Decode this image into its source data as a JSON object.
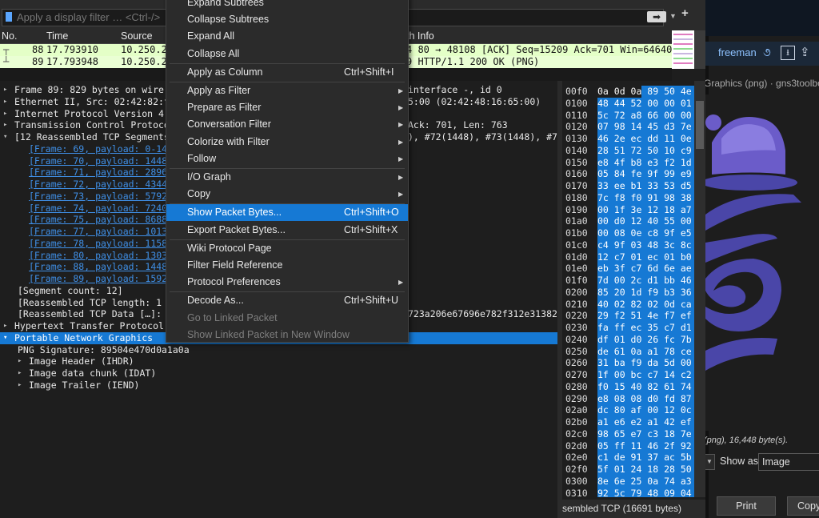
{
  "filter": {
    "placeholder": "Apply a display filter … <Ctrl-/>",
    "arrow_label": "➡",
    "dropdown": "▼",
    "add": "+"
  },
  "packet_list": {
    "columns": [
      "No.",
      "Time",
      "Source",
      "th Info"
    ],
    "rows": [
      {
        "no": "88",
        "time": "17.793910",
        "source": "10.250.25",
        "info": "4 80 → 48108 [ACK] Seq=15209 Ack=701 Win=64640 Len="
      },
      {
        "no": "89",
        "time": "17.793948",
        "source": "10.250.25",
        "info": "9 HTTP/1.1 200 OK  (PNG)"
      }
    ]
  },
  "details": {
    "lines": [
      {
        "text": "Frame 89: 829 bytes on wire (",
        "tail": "interface -, id 0",
        "twisty": "▸"
      },
      {
        "text": "Ethernet II, Src: 02:42:82:f7",
        "tail": "5:00 (02:42:48:16:65:00)",
        "twisty": "▸"
      },
      {
        "text": "Internet Protocol Version 4,",
        "tail": "",
        "twisty": "▸"
      },
      {
        "text": "Transmission Control Protocol",
        "tail": "Ack: 701, Len: 763",
        "twisty": "▸"
      },
      {
        "text": "[12 Reassembled TCP Segments",
        "tail": "), #72(1448), #73(1448), #74(",
        "twisty": "▾"
      },
      {
        "text": "[Frame: 69, payload: 0-144",
        "link": true
      },
      {
        "text": "[Frame: 70, payload: 1448-",
        "link": true
      },
      {
        "text": "[Frame: 71, payload: 2896-",
        "link": true
      },
      {
        "text": "[Frame: 72, payload: 4344-",
        "link": true
      },
      {
        "text": "[Frame: 73, payload: 5792-",
        "link": true
      },
      {
        "text": "[Frame: 74, payload: 7240-",
        "link": true
      },
      {
        "text": "[Frame: 75, payload: 8688-",
        "link": true
      },
      {
        "text": "[Frame: 77, payload: 10136",
        "link": true
      },
      {
        "text": "[Frame: 78, payload: 11584",
        "link": true
      },
      {
        "text": "[Frame: 80, payload: 13032",
        "link": true
      },
      {
        "text": "[Frame: 88, payload: 14480",
        "link": true
      },
      {
        "text": "[Frame: 89, payload: 15928",
        "link": true
      },
      {
        "text": "[Segment count: 12]"
      },
      {
        "text": "[Reassembled TCP length: 1"
      },
      {
        "text": "[Reassembled TCP Data […]:",
        "tail": "723a206e67696e782f312e31382e3"
      },
      {
        "text": "Hypertext Transfer Protocol",
        "twisty": "▸"
      },
      {
        "text": "Portable Network Graphics",
        "twisty": "▾",
        "selected": true
      },
      {
        "text": "PNG Signature: 89504e470d0a1a0a"
      },
      {
        "text": "Image Header (IHDR)",
        "twisty": "▸"
      },
      {
        "text": "Image data chunk (IDAT)",
        "twisty": "▸"
      },
      {
        "text": "Image Trailer (IEND)",
        "twisty": "▸"
      }
    ]
  },
  "hex": {
    "rows": [
      {
        "off": "00f0",
        "bytes": "0a 0d 0a 89 50 4e",
        "partial": true
      },
      {
        "off": "0100",
        "bytes": "48 44 52 00 00 01"
      },
      {
        "off": "0110",
        "bytes": "5c 72 a8 66 00 00"
      },
      {
        "off": "0120",
        "bytes": "07 98 14 45 d3 7e"
      },
      {
        "off": "0130",
        "bytes": "46 2e ec dd 11 0e"
      },
      {
        "off": "0140",
        "bytes": "28 51 72 50 10 c9"
      },
      {
        "off": "0150",
        "bytes": "e8 4f b8 e3 f2 1d"
      },
      {
        "off": "0160",
        "bytes": "05 84 fe 9f 99 e9"
      },
      {
        "off": "0170",
        "bytes": "33 ee b1 33 53 d5"
      },
      {
        "off": "0180",
        "bytes": "7c f8 f0 91 98 38"
      },
      {
        "off": "0190",
        "bytes": "00 1f 3e 12 18 a7"
      },
      {
        "off": "01a0",
        "bytes": "00 d0 12 40 55 00"
      },
      {
        "off": "01b0",
        "bytes": "00 08 0e c8 9f e5"
      },
      {
        "off": "01c0",
        "bytes": "c4 9f 03 48 3c 8c"
      },
      {
        "off": "01d0",
        "bytes": "12 c7 01 ec 01 b0"
      },
      {
        "off": "01e0",
        "bytes": "eb 3f c7 6d 6e ae"
      },
      {
        "off": "01f0",
        "bytes": "7d 00 2c d1 bb 46"
      },
      {
        "off": "0200",
        "bytes": "85 20 1d f9 b3 36"
      },
      {
        "off": "0210",
        "bytes": "40 02 82 02 0d ca"
      },
      {
        "off": "0220",
        "bytes": "29 f2 51 4e f7 ef"
      },
      {
        "off": "0230",
        "bytes": "fa ff ec 35 c7 d1"
      },
      {
        "off": "0240",
        "bytes": "df 01 d0 26 fc 7b"
      },
      {
        "off": "0250",
        "bytes": "de 61 0a a1 78 ce"
      },
      {
        "off": "0260",
        "bytes": "31 ba f9 da 5d 00"
      },
      {
        "off": "0270",
        "bytes": "1f 00 bc c7 14 c2"
      },
      {
        "off": "0280",
        "bytes": "f0 15 40 82 61 74"
      },
      {
        "off": "0290",
        "bytes": "e8 08 08 d0 fd 87"
      },
      {
        "off": "02a0",
        "bytes": "dc 80 af 00 12 0c"
      },
      {
        "off": "02b0",
        "bytes": "a1 e6 e2 a1 42 ef"
      },
      {
        "off": "02c0",
        "bytes": "98 65 e7 c3 18 7e"
      },
      {
        "off": "02d0",
        "bytes": "05 ff 11 46 2f 92"
      },
      {
        "off": "02e0",
        "bytes": "c1 de 91 37 ac 5b"
      },
      {
        "off": "02f0",
        "bytes": "5f 01 24 18 28 50"
      },
      {
        "off": "0300",
        "bytes": "8e 6e 25 0a 74 a3"
      },
      {
        "off": "0310",
        "bytes": "92 5c 79 48 09 04"
      },
      {
        "off": "0320",
        "bytes": "13 6a 11 ba 41 08"
      }
    ],
    "status": "sembled TCP (16691 bytes)"
  },
  "context_menu": {
    "items": [
      {
        "label": "Expand Subtrees",
        "shortcut": "",
        "submenu": false
      },
      {
        "label": "Collapse Subtrees",
        "shortcut": "",
        "submenu": false
      },
      {
        "label": "Expand All",
        "shortcut": "",
        "submenu": false
      },
      {
        "label": "Collapse All",
        "shortcut": "",
        "submenu": false
      },
      {
        "sep": true
      },
      {
        "label": "Apply as Column",
        "shortcut": "Ctrl+Shift+I",
        "submenu": false
      },
      {
        "sep": true
      },
      {
        "label": "Apply as Filter",
        "shortcut": "",
        "submenu": true
      },
      {
        "label": "Prepare as Filter",
        "shortcut": "",
        "submenu": true
      },
      {
        "label": "Conversation Filter",
        "shortcut": "",
        "submenu": true
      },
      {
        "label": "Colorize with Filter",
        "shortcut": "",
        "submenu": true
      },
      {
        "label": "Follow",
        "shortcut": "",
        "submenu": true
      },
      {
        "sep": true
      },
      {
        "label": "I/O Graph",
        "shortcut": "",
        "submenu": true
      },
      {
        "label": "Copy",
        "shortcut": "",
        "submenu": true
      },
      {
        "sep": true
      },
      {
        "label": "Show Packet Bytes...",
        "shortcut": "Ctrl+Shift+O",
        "submenu": false,
        "highlighted": true
      },
      {
        "label": "Export Packet Bytes...",
        "shortcut": "Ctrl+Shift+X",
        "submenu": false
      },
      {
        "sep": true
      },
      {
        "label": "Wiki Protocol Page",
        "shortcut": "",
        "submenu": false
      },
      {
        "label": "Filter Field Reference",
        "shortcut": "",
        "submenu": false
      },
      {
        "label": "Protocol Preferences",
        "shortcut": "",
        "submenu": true
      },
      {
        "sep": true
      },
      {
        "label": "Decode As...",
        "shortcut": "Ctrl+Shift+U",
        "submenu": false
      },
      {
        "label": "Go to Linked Packet",
        "shortcut": "",
        "submenu": false,
        "disabled": true
      },
      {
        "label": "Show Linked Packet in New Window",
        "shortcut": "",
        "submenu": false,
        "disabled": true
      }
    ]
  },
  "side_window": {
    "username": "freeman",
    "title": "Graphics (png) · gns3toolboxW",
    "info": "(png), 16,448 byte(s).",
    "show_as_label": "Show as",
    "show_as_value": "Image",
    "print_label": "Print",
    "copy_label": "Copy"
  },
  "colors": {
    "selection": "#1679d4",
    "link": "#3f8fe6",
    "row_green": "#e4ffc7"
  }
}
